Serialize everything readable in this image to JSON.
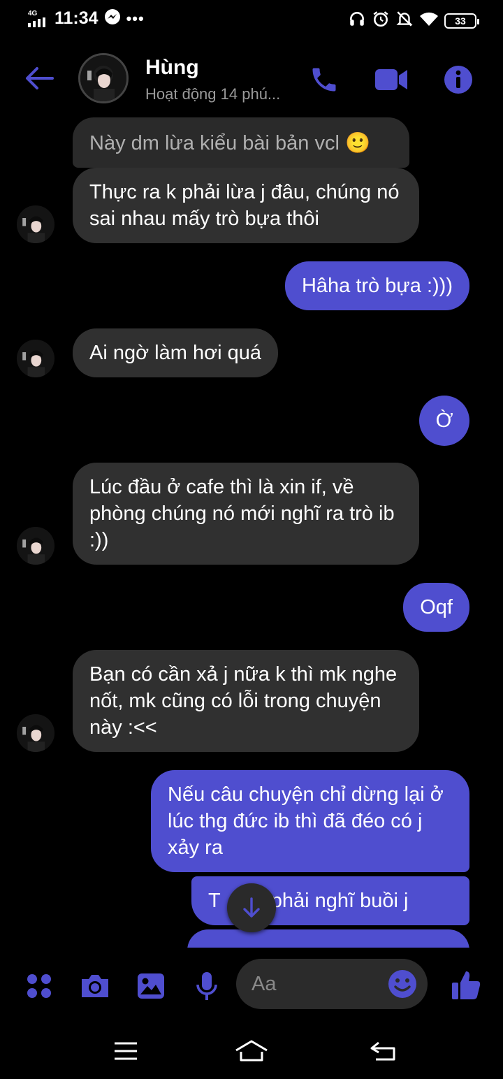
{
  "status_bar": {
    "network": "4G",
    "time": "11:34",
    "more": "•••",
    "battery": "33"
  },
  "header": {
    "name": "Hùng",
    "status": "Hoạt động 14 phú..."
  },
  "messages": [
    {
      "side": "recv",
      "text": "Này dm lừa kiểu bài bản vcl 🙂"
    },
    {
      "side": "recv",
      "text": "Thực ra k phải lừa j đâu, chúng nó sai nhau mấy trò bựa thôi"
    },
    {
      "side": "sent",
      "text": "Hâha trò bựa :)))"
    },
    {
      "side": "recv",
      "text": "Ai ngờ làm hơi quá"
    },
    {
      "side": "sent",
      "text": "Ờ"
    },
    {
      "side": "recv",
      "text": "Lúc đầu ở cafe thì là xin if, về phòng chúng nó mới nghĩ ra trò ib :))"
    },
    {
      "side": "sent",
      "text": "Oqf"
    },
    {
      "side": "recv",
      "text": "Bạn có cần xả j nữa k thì mk nghe nốt, mk cũng có lỗi trong chuyện này :<<"
    },
    {
      "side": "sent",
      "text": "Nếu câu chuyện chỉ dừng lại ở lúc thg đức ib thì đã đéo có j xảy ra"
    },
    {
      "side": "sent",
      "text": "T    éo phải nghĩ buồi j"
    }
  ],
  "composer": {
    "placeholder": "Aa"
  },
  "colors": {
    "accent": "#4f4ecf",
    "received_bubble": "#303030",
    "background": "#000000"
  }
}
